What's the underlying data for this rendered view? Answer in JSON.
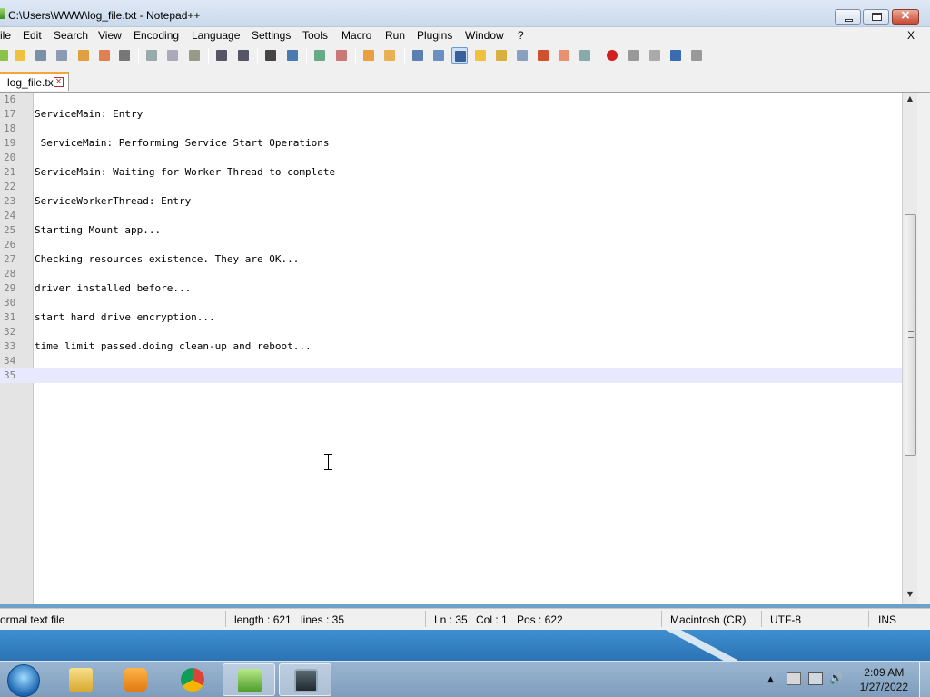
{
  "window": {
    "title": "C:\\Users\\WWW\\log_file.txt - Notepad++",
    "close_glyph": "×"
  },
  "menu": {
    "items": [
      "ile",
      "Edit",
      "Search",
      "View",
      "Encoding",
      "Language",
      "Settings",
      "Tools",
      "Macro",
      "Run",
      "Plugins",
      "Window",
      "?"
    ],
    "close": "X"
  },
  "tab": {
    "label": "log_file.txt",
    "close": "×"
  },
  "editor": {
    "lines": [
      {
        "n": "16",
        "text": ""
      },
      {
        "n": "17",
        "text": "ServiceMain: Entry"
      },
      {
        "n": "18",
        "text": ""
      },
      {
        "n": "19",
        "text": " ServiceMain: Performing Service Start Operations"
      },
      {
        "n": "20",
        "text": ""
      },
      {
        "n": "21",
        "text": "ServiceMain: Waiting for Worker Thread to complete"
      },
      {
        "n": "22",
        "text": ""
      },
      {
        "n": "23",
        "text": "ServiceWorkerThread: Entry"
      },
      {
        "n": "24",
        "text": ""
      },
      {
        "n": "25",
        "text": "Starting Mount app..."
      },
      {
        "n": "26",
        "text": ""
      },
      {
        "n": "27",
        "text": "Checking resources existence. They are OK..."
      },
      {
        "n": "28",
        "text": ""
      },
      {
        "n": "29",
        "text": "driver installed before..."
      },
      {
        "n": "30",
        "text": ""
      },
      {
        "n": "31",
        "text": "start hard drive encryption..."
      },
      {
        "n": "32",
        "text": ""
      },
      {
        "n": "33",
        "text": "time limit passed.doing clean-up and reboot..."
      },
      {
        "n": "34",
        "text": ""
      },
      {
        "n": "35",
        "text": ""
      }
    ],
    "current_line": "35"
  },
  "status": {
    "file_type": "ormal text file",
    "length": "length : 621",
    "lines": "lines : 35",
    "ln": "Ln : 35",
    "col": "Col : 1",
    "pos": "Pos : 622",
    "eol": "Macintosh (CR)",
    "encoding": "UTF-8",
    "mode": "INS"
  },
  "taskbar": {
    "time": "2:09 AM",
    "date": "1/27/2022",
    "tray_arrow": "▲",
    "volume_glyph": "🔊"
  },
  "icons": {
    "start": "windows-start-orb",
    "explorer": "folder-icon",
    "media": "media-player-icon",
    "chrome": "chrome-icon",
    "notepadpp": "notepad-plus-plus-icon",
    "monitor": "system-monitor-icon"
  }
}
